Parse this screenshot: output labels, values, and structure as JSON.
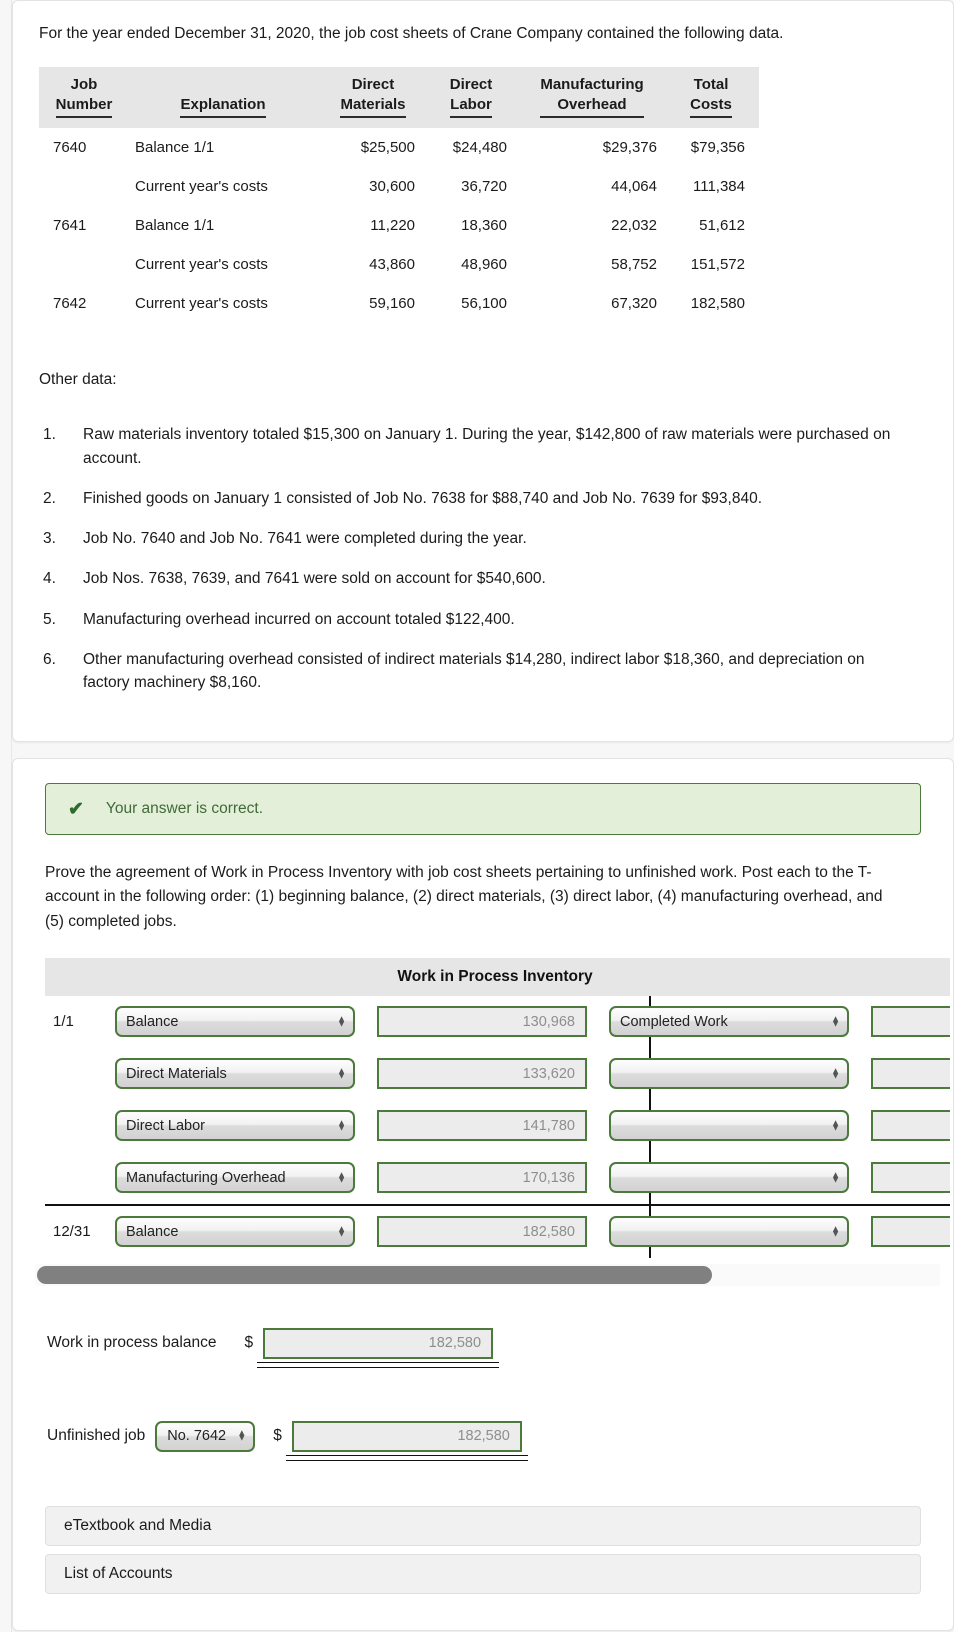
{
  "problem": {
    "intro": "For the year ended December 31, 2020, the job cost sheets of Crane Company contained the following data.",
    "table": {
      "headers": [
        {
          "line1": "Job",
          "line2": "Number"
        },
        {
          "line1": "",
          "line2": "Explanation"
        },
        {
          "line1": "Direct",
          "line2": "Materials"
        },
        {
          "line1": "Direct",
          "line2": "Labor"
        },
        {
          "line1": "Manufacturing",
          "line2": "Overhead"
        },
        {
          "line1": "Total",
          "line2": "Costs"
        }
      ],
      "rows": [
        {
          "job": "7640",
          "explanation": "Balance 1/1",
          "direct_materials": "$25,500",
          "direct_labor": "$24,480",
          "manufacturing_overhead": "$29,376",
          "total_costs": "$79,356"
        },
        {
          "job": "",
          "explanation": "Current year's costs",
          "direct_materials": "30,600",
          "direct_labor": "36,720",
          "manufacturing_overhead": "44,064",
          "total_costs": "111,384"
        },
        {
          "job": "7641",
          "explanation": "Balance 1/1",
          "direct_materials": "11,220",
          "direct_labor": "18,360",
          "manufacturing_overhead": "22,032",
          "total_costs": "51,612"
        },
        {
          "job": "",
          "explanation": "Current year's costs",
          "direct_materials": "43,860",
          "direct_labor": "48,960",
          "manufacturing_overhead": "58,752",
          "total_costs": "151,572"
        },
        {
          "job": "7642",
          "explanation": "Current year's costs",
          "direct_materials": "59,160",
          "direct_labor": "56,100",
          "manufacturing_overhead": "67,320",
          "total_costs": "182,580"
        }
      ]
    },
    "other_data_label": "Other data:",
    "other_data": [
      {
        "num": "1.",
        "text": "Raw materials inventory totaled $15,300 on January 1. During the year, $142,800 of raw materials were purchased on account."
      },
      {
        "num": "2.",
        "text": "Finished goods on January 1 consisted of Job No. 7638 for $88,740 and Job No. 7639 for $93,840."
      },
      {
        "num": "3.",
        "text": "Job No. 7640 and Job No. 7641 were completed during the year."
      },
      {
        "num": "4.",
        "text": "Job Nos. 7638, 7639, and 7641 were sold on account for $540,600."
      },
      {
        "num": "5.",
        "text": "Manufacturing overhead incurred on account totaled $122,400."
      },
      {
        "num": "6.",
        "text": "Other manufacturing overhead consisted of indirect materials $14,280, indirect labor $18,360, and depreciation on factory machinery $8,160."
      }
    ]
  },
  "answer": {
    "banner": {
      "icon": "check-icon",
      "text": "Your answer is correct.",
      "bg_color": "#e3efd9",
      "border_color": "#4b7a3c",
      "text_color": "#3f6b38"
    },
    "prompt": "Prove the agreement of Work in Process Inventory with job cost sheets pertaining to unfinished work. Post each to the T-account in the following order: (1) beginning balance, (2) direct materials, (3) direct labor, (4) manufacturing overhead, and (5) completed jobs.",
    "taccount": {
      "title": "Work in Process Inventory",
      "rows": [
        {
          "date": "1/1",
          "debit_label": "Balance",
          "debit_amount": "130,968",
          "credit_label": "Completed Work",
          "credit_amount": ""
        },
        {
          "date": "",
          "debit_label": "Direct Materials",
          "debit_amount": "133,620",
          "credit_label": "",
          "credit_amount": ""
        },
        {
          "date": "",
          "debit_label": "Direct Labor",
          "debit_amount": "141,780",
          "credit_label": "",
          "credit_amount": ""
        },
        {
          "date": "",
          "debit_label": "Manufacturing Overhead",
          "debit_amount": "170,136",
          "credit_label": "",
          "credit_amount": ""
        }
      ],
      "total_row": {
        "date": "12/31",
        "debit_label": "Balance",
        "debit_amount": "182,580",
        "credit_label": "",
        "credit_amount": ""
      }
    },
    "wip_balance": {
      "label": "Work in process balance",
      "currency": "$",
      "value": "182,580"
    },
    "unfinished_job": {
      "label": "Unfinished job",
      "job_select_value": "No. 7642",
      "currency": "$",
      "value": "182,580"
    },
    "buttons": [
      {
        "label": "eTextbook and Media"
      },
      {
        "label": "List of Accounts"
      }
    ]
  }
}
